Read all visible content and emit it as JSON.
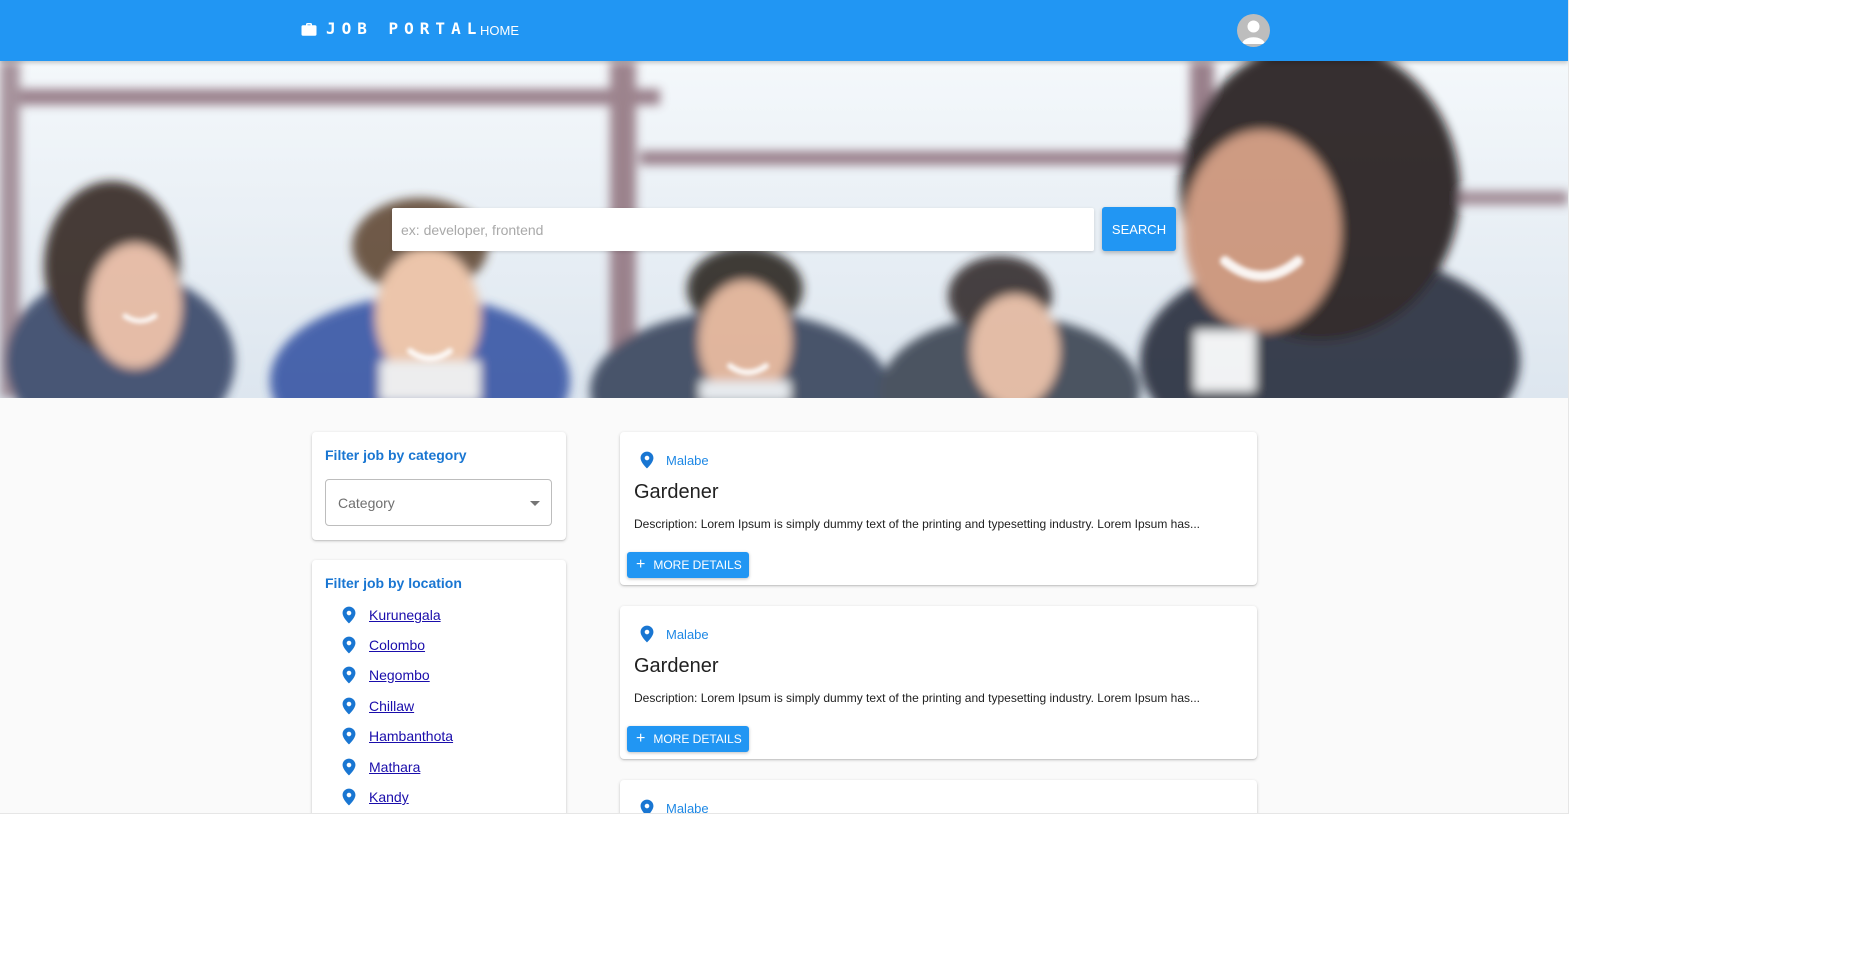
{
  "header": {
    "brand": "JOB PORTAL",
    "nav_home": "HOME"
  },
  "search": {
    "placeholder": "ex: developer, frontend",
    "button": "SEARCH"
  },
  "filters": {
    "category": {
      "title": "Filter job by category",
      "select_label": "Category"
    },
    "location": {
      "title": "Filter job by location",
      "items": [
        "Kurunegala",
        "Colombo",
        "Negombo",
        "Chillaw",
        "Hambanthota",
        "Mathara",
        "Kandy"
      ]
    }
  },
  "jobs": [
    {
      "location": "Malabe",
      "title": "Gardener",
      "description": "Description: Lorem Ipsum is simply dummy text of the printing and typesetting industry. Lorem Ipsum has...",
      "button": "MORE DETAILS"
    },
    {
      "location": "Malabe",
      "title": "Gardener",
      "description": "Description: Lorem Ipsum is simply dummy text of the printing and typesetting industry. Lorem Ipsum has...",
      "button": "MORE DETAILS"
    },
    {
      "location": "Malabe"
    }
  ],
  "icons": {
    "brand": "briefcase-icon",
    "avatar": "account-circle-icon",
    "location": "location-pin-icon",
    "add": "plus-icon"
  },
  "colors": {
    "primary": "#2196f3",
    "filter_title": "#1976d2",
    "location_link": "#1a0dab",
    "pin": "#1976d2"
  }
}
